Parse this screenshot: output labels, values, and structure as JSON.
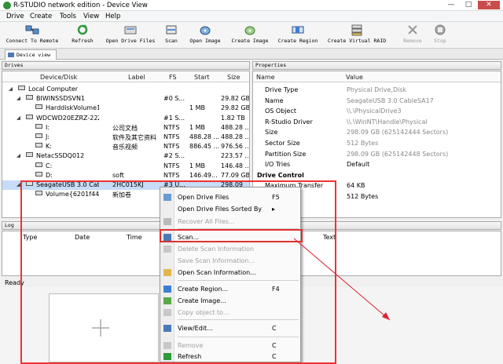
{
  "window": {
    "title": "R-STUDIO network edition - Device View",
    "minimize": "—",
    "maximize": "□",
    "close": "✕"
  },
  "menu": [
    "Drive",
    "Create",
    "Tools",
    "View",
    "Help"
  ],
  "toolbar": [
    {
      "label": "Connect To Remote",
      "icon": "connect-icon",
      "enabled": true
    },
    {
      "label": "Refresh",
      "icon": "refresh-icon",
      "enabled": true
    },
    {
      "label": "Open Drive Files",
      "icon": "open-drive-icon",
      "enabled": true
    },
    {
      "label": "Scan",
      "icon": "scan-icon",
      "enabled": true
    },
    {
      "label": "Open Image",
      "icon": "open-image-icon",
      "enabled": true
    },
    {
      "label": "Create Image",
      "icon": "create-image-icon",
      "enabled": true
    },
    {
      "label": "Create Region",
      "icon": "create-region-icon",
      "enabled": true
    },
    {
      "label": "Create Virtual RAID",
      "icon": "raid-icon",
      "enabled": true
    },
    {
      "label": "Remove",
      "icon": "remove-icon",
      "enabled": false
    },
    {
      "label": "Stop",
      "icon": "stop-icon",
      "enabled": false
    }
  ],
  "tab": "Device view",
  "drives_panel": {
    "title": "Drives",
    "columns": [
      "Device/Disk",
      "Label",
      "FS",
      "Start",
      "Size"
    ],
    "rows": [
      {
        "name": "Local Computer",
        "label": "",
        "fs": "",
        "start": "",
        "size": ""
      },
      {
        "name": "BIWINSSDSVN1",
        "label": "",
        "fs": "#0 S...",
        "start": "",
        "size": "29.82 GB"
      },
      {
        "name": "HarddiskVolume1",
        "label": "",
        "fs": "",
        "start": "1 MB",
        "size": "29.82 GB"
      },
      {
        "name": "WDCWD20EZRZ-22Z5...",
        "label": "",
        "fs": "#1 S...",
        "start": "",
        "size": "1.82 TB"
      },
      {
        "name": "I:",
        "label": "公司文档",
        "fs": "NTFS",
        "start": "1 MB",
        "size": "488.28 ..."
      },
      {
        "name": "J:",
        "label": "软件及其它资料",
        "fs": "NTFS",
        "start": "488.28 ...",
        "size": "488.28 ..."
      },
      {
        "name": "K:",
        "label": "音乐视频",
        "fs": "NTFS",
        "start": "886.45 ...",
        "size": "976.56 ..."
      },
      {
        "name": "NetacSSDQ012",
        "label": "",
        "fs": "#2 S...",
        "start": "",
        "size": "223.57 ..."
      },
      {
        "name": "C:",
        "label": "",
        "fs": "NTFS",
        "start": "1 MB",
        "size": "146.48 ..."
      },
      {
        "name": "D:",
        "label": "soft",
        "fs": "NTFS",
        "start": "146.49...",
        "size": "77.09 GB"
      },
      {
        "name": "SeagateUSB 3.0 Cable...",
        "label": "2HC015KJ",
        "fs": "#3 U...",
        "start": "",
        "size": "298.09"
      },
      {
        "name": "Volume{6201f440-...",
        "label": "新加卷",
        "fs": "",
        "start": "",
        "size": ""
      }
    ]
  },
  "properties_panel": {
    "title": "Properties",
    "columns": [
      "Name",
      "Value"
    ],
    "rows": [
      {
        "name": "Drive Type",
        "value": "Physical Drive,Disk"
      },
      {
        "name": "Name",
        "value": "SeagateUSB 3.0 CableSA17"
      },
      {
        "name": "OS Object",
        "value": "\\\\.\\PhysicalDrive3"
      },
      {
        "name": "R-Studio Driver",
        "value": "\\\\.\\WinNT\\Handle\\Physical"
      },
      {
        "name": "Size",
        "value": "298.09 GB (625142444 Sectors)"
      },
      {
        "name": "Sector Size",
        "value": "512 Bytes"
      },
      {
        "name": "Partition Size",
        "value": "298.09 GB (625142448 Sectors)"
      },
      {
        "name": "I/O Tries",
        "value": "Default"
      },
      {
        "name": "Drive Control",
        "value": ""
      },
      {
        "name": "Maximum Transfer",
        "value": "64 KB"
      },
      {
        "name": "",
        "value": "512 Bytes"
      }
    ]
  },
  "log_panel": {
    "title": "Log",
    "columns": [
      "Type",
      "Date",
      "Time",
      "Text"
    ]
  },
  "status": "Ready",
  "context_menu": [
    {
      "label": "Open Drive Files",
      "shortcut": "F5",
      "enabled": true,
      "icon": "open-drive-icon"
    },
    {
      "label": "Open Drive Files Sorted By",
      "shortcut": "▸",
      "enabled": true,
      "icon": ""
    },
    {
      "label": "Recover All Files...",
      "shortcut": "",
      "enabled": false,
      "icon": "recover-icon"
    },
    {
      "label": "Scan...",
      "shortcut": "",
      "enabled": true,
      "icon": "scan-icon"
    },
    {
      "label": "Delete Scan Information",
      "shortcut": "",
      "enabled": false,
      "icon": "delete-icon"
    },
    {
      "label": "Save Scan Information...",
      "shortcut": "",
      "enabled": false,
      "icon": ""
    },
    {
      "label": "Open Scan Information...",
      "shortcut": "",
      "enabled": true,
      "icon": "open-icon"
    },
    {
      "label": "Create Region...",
      "shortcut": "F4",
      "enabled": true,
      "icon": "create-region-icon"
    },
    {
      "label": "Create Image...",
      "shortcut": "",
      "enabled": true,
      "icon": "create-image-icon"
    },
    {
      "label": "Copy object to...",
      "shortcut": "",
      "enabled": false,
      "icon": "copy-icon"
    },
    {
      "label": "View/Edit...",
      "shortcut": "C",
      "enabled": true,
      "icon": "view-edit-icon"
    },
    {
      "label": "Remove",
      "shortcut": "C",
      "enabled": false,
      "icon": "remove-icon"
    },
    {
      "label": "Refresh",
      "shortcut": "C",
      "enabled": true,
      "icon": "refresh-icon"
    }
  ],
  "colors": {
    "accent": "#3c7fd1",
    "highlight": "#e03030",
    "selection": "#c7dcf6"
  }
}
